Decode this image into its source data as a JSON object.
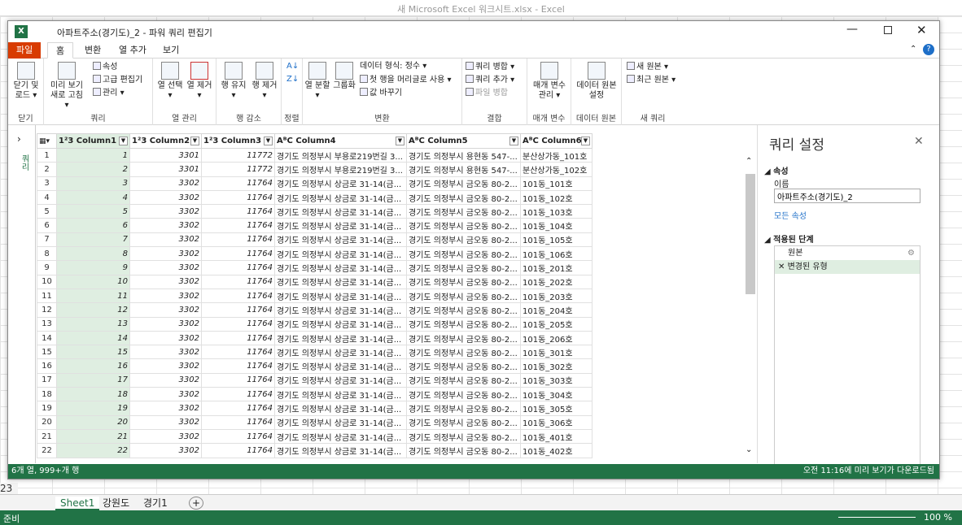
{
  "excel": {
    "window_title": "새 Microsoft Excel 워크시트.xlsx - Excel",
    "row_23": "23",
    "sheets": [
      "Sheet1",
      "강원도",
      "경기1"
    ],
    "status": "준비",
    "zoom": "100 %"
  },
  "pq": {
    "title": "아파트주소(경기도)_2 - 파워 쿼리 편집기",
    "tabs": [
      "파일",
      "홈",
      "변환",
      "열 추가",
      "보기"
    ],
    "ribbon": {
      "close_load": "닫기 및 로드 ▾",
      "refresh": "미리 보기 새로 고침 ▾",
      "properties": "속성",
      "advanced_editor": "고급 편집기",
      "manage": "관리 ▾",
      "choose_cols": "열 선택 ▾",
      "remove_cols": "열 제거 ▾",
      "keep_rows": "행 유지 ▾",
      "remove_rows": "행 제거 ▾",
      "split_col": "열 분할 ▾",
      "group_by": "그룹화",
      "data_type": "데이터 형식: 정수 ▾",
      "first_row_header": "첫 행을 머리글로 사용 ▾",
      "replace_values": "값 바꾸기",
      "merge_queries": "쿼리 병합 ▾",
      "append_queries": "쿼리 추가 ▾",
      "combine_files": "파일 병합",
      "manage_params": "매개 변수 관리 ▾",
      "data_source_settings": "데이터 원본 설정",
      "new_source": "새 원본 ▾",
      "recent_sources": "최근 원본 ▾",
      "groups": [
        "닫기",
        "쿼리",
        "열 관리",
        "행 감소",
        "정렬",
        "변환",
        "결합",
        "매개 변수",
        "데이터 원본",
        "새 쿼리"
      ]
    },
    "nav_label": "쿼리",
    "columns": [
      {
        "type": "1²3",
        "name": "Column1"
      },
      {
        "type": "1²3",
        "name": "Column2"
      },
      {
        "type": "1²3",
        "name": "Column3"
      },
      {
        "type": "AᴮC",
        "name": "Column4"
      },
      {
        "type": "AᴮC",
        "name": "Column5"
      },
      {
        "type": "AᴮC",
        "name": "Column6"
      }
    ],
    "rows": [
      [
        "1",
        "1",
        "3301",
        "11772",
        "경기도 의정부시 부용로219번길 3...",
        "경기도 의정부시 용현동 547-...",
        "분산상가동_101호"
      ],
      [
        "2",
        "2",
        "3301",
        "11772",
        "경기도 의정부시 부용로219번길 3...",
        "경기도 의정부시 용현동 547-...",
        "분산상가동_102호"
      ],
      [
        "3",
        "3",
        "3302",
        "11764",
        "경기도 의정부시 상금로 31-14(금...",
        "경기도 의정부시 금오동 80-2...",
        "101동_101호"
      ],
      [
        "4",
        "4",
        "3302",
        "11764",
        "경기도 의정부시 상금로 31-14(금...",
        "경기도 의정부시 금오동 80-2...",
        "101동_102호"
      ],
      [
        "5",
        "5",
        "3302",
        "11764",
        "경기도 의정부시 상금로 31-14(금...",
        "경기도 의정부시 금오동 80-2...",
        "101동_103호"
      ],
      [
        "6",
        "6",
        "3302",
        "11764",
        "경기도 의정부시 상금로 31-14(금...",
        "경기도 의정부시 금오동 80-2...",
        "101동_104호"
      ],
      [
        "7",
        "7",
        "3302",
        "11764",
        "경기도 의정부시 상금로 31-14(금...",
        "경기도 의정부시 금오동 80-2...",
        "101동_105호"
      ],
      [
        "8",
        "8",
        "3302",
        "11764",
        "경기도 의정부시 상금로 31-14(금...",
        "경기도 의정부시 금오동 80-2...",
        "101동_106호"
      ],
      [
        "9",
        "9",
        "3302",
        "11764",
        "경기도 의정부시 상금로 31-14(금...",
        "경기도 의정부시 금오동 80-2...",
        "101동_201호"
      ],
      [
        "10",
        "10",
        "3302",
        "11764",
        "경기도 의정부시 상금로 31-14(금...",
        "경기도 의정부시 금오동 80-2...",
        "101동_202호"
      ],
      [
        "11",
        "11",
        "3302",
        "11764",
        "경기도 의정부시 상금로 31-14(금...",
        "경기도 의정부시 금오동 80-2...",
        "101동_203호"
      ],
      [
        "12",
        "12",
        "3302",
        "11764",
        "경기도 의정부시 상금로 31-14(금...",
        "경기도 의정부시 금오동 80-2...",
        "101동_204호"
      ],
      [
        "13",
        "13",
        "3302",
        "11764",
        "경기도 의정부시 상금로 31-14(금...",
        "경기도 의정부시 금오동 80-2...",
        "101동_205호"
      ],
      [
        "14",
        "14",
        "3302",
        "11764",
        "경기도 의정부시 상금로 31-14(금...",
        "경기도 의정부시 금오동 80-2...",
        "101동_206호"
      ],
      [
        "15",
        "15",
        "3302",
        "11764",
        "경기도 의정부시 상금로 31-14(금...",
        "경기도 의정부시 금오동 80-2...",
        "101동_301호"
      ],
      [
        "16",
        "16",
        "3302",
        "11764",
        "경기도 의정부시 상금로 31-14(금...",
        "경기도 의정부시 금오동 80-2...",
        "101동_302호"
      ],
      [
        "17",
        "17",
        "3302",
        "11764",
        "경기도 의정부시 상금로 31-14(금...",
        "경기도 의정부시 금오동 80-2...",
        "101동_303호"
      ],
      [
        "18",
        "18",
        "3302",
        "11764",
        "경기도 의정부시 상금로 31-14(금...",
        "경기도 의정부시 금오동 80-2...",
        "101동_304호"
      ],
      [
        "19",
        "19",
        "3302",
        "11764",
        "경기도 의정부시 상금로 31-14(금...",
        "경기도 의정부시 금오동 80-2...",
        "101동_305호"
      ],
      [
        "20",
        "20",
        "3302",
        "11764",
        "경기도 의정부시 상금로 31-14(금...",
        "경기도 의정부시 금오동 80-2...",
        "101동_306호"
      ],
      [
        "21",
        "21",
        "3302",
        "11764",
        "경기도 의정부시 상금로 31-14(금...",
        "경기도 의정부시 금오동 80-2...",
        "101동_401호"
      ],
      [
        "22",
        "22",
        "3302",
        "11764",
        "경기도 의정부시 상금로 31-14(금...",
        "경기도 의정부시 금오동 80-2...",
        "101동_402호"
      ]
    ],
    "settings": {
      "title": "쿼리 설정",
      "properties_header": "속성",
      "name_label": "이름",
      "name_value": "아파트주소(경기도)_2",
      "all_properties": "모든 속성",
      "steps_header": "적용된 단계",
      "steps": [
        "원본",
        "변경된 유형"
      ]
    },
    "status_left": "6개 열, 999+개 행",
    "status_right": "오전 11:16에 미리 보기가 다운로드됨"
  },
  "colors": {
    "excel_green": "#217346",
    "file_tab": "#d83b01",
    "selected_col": "#dfeee1"
  }
}
